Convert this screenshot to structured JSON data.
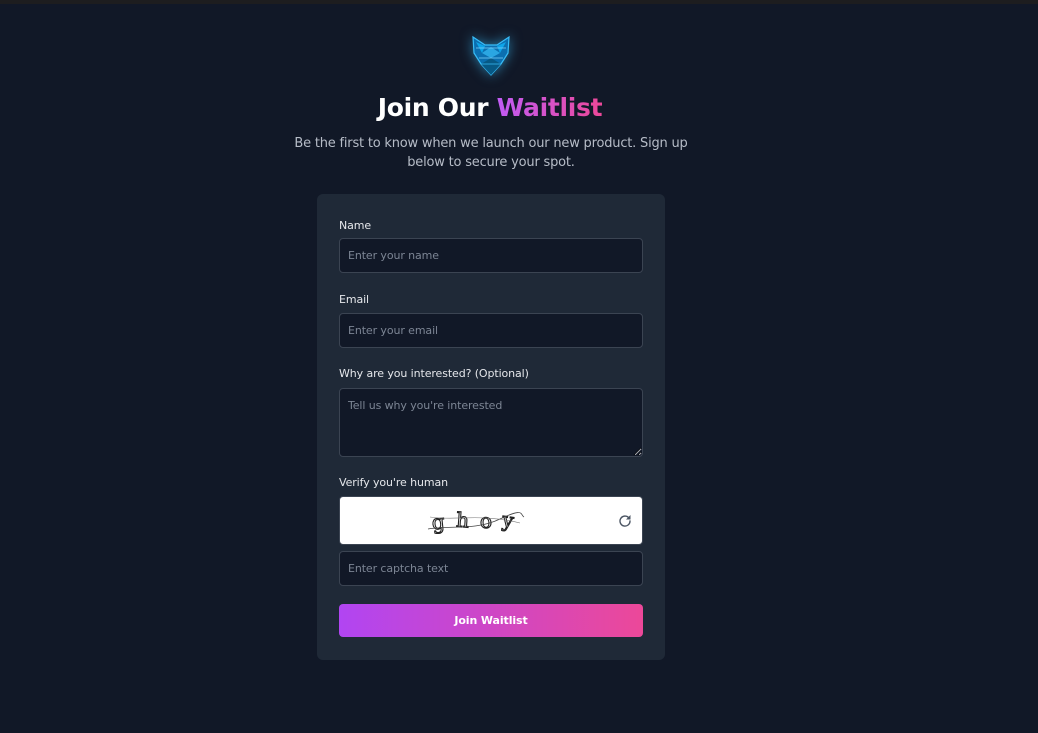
{
  "header": {
    "logo_icon": "fox-icon",
    "title_main": "Join Our",
    "title_accent": "Waitlist",
    "subtitle": "Be the first to know when we launch our new product. Sign up below to secure your spot."
  },
  "form": {
    "name": {
      "label": "Name",
      "placeholder": "Enter your name",
      "value": ""
    },
    "email": {
      "label": "Email",
      "placeholder": "Enter your email",
      "value": ""
    },
    "interest": {
      "label": "Why are you interested? (Optional)",
      "placeholder": "Tell us why you're interested",
      "value": ""
    },
    "captcha": {
      "label": "Verify you're human",
      "text": "ghoy",
      "refresh_icon": "refresh-icon",
      "placeholder": "Enter captcha text",
      "value": ""
    },
    "submit_label": "Join Waitlist"
  },
  "colors": {
    "background": "#111827",
    "card": "#1f2937",
    "accent_start": "#b145f2",
    "accent_end": "#ec4899",
    "logo": "#0ea5e9"
  }
}
